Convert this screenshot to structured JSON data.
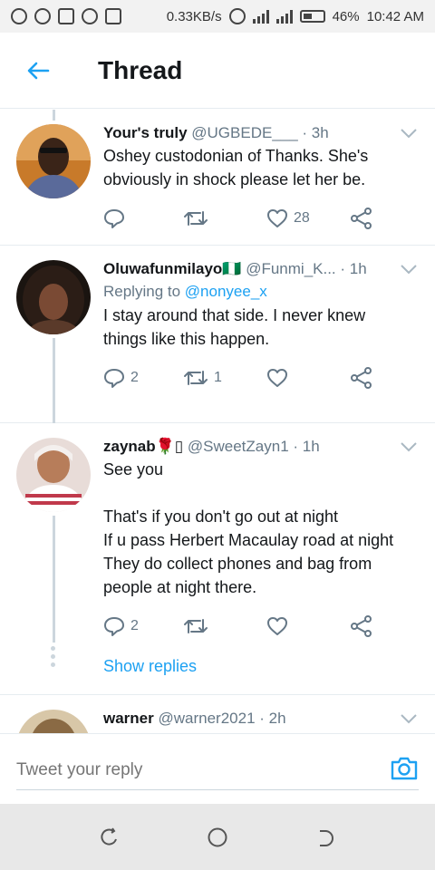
{
  "status_bar": {
    "speed": "0.33KB/s",
    "battery": "46%",
    "time": "10:42 AM",
    "battery_level": 0.46
  },
  "header": {
    "title": "Thread"
  },
  "tweets": [
    {
      "name": "Your's truly",
      "handle": "@UGBEDE___",
      "time": "· 3h",
      "replying_label": "",
      "replying_to": "",
      "text": "Oshey custodonian of Thanks. She's obviously in shock please let her be.",
      "reply_count": "",
      "retweet_count": "",
      "like_count": "28"
    },
    {
      "name": "Oluwafunmilayo🇳🇬",
      "handle": "@Funmi_K...",
      "time": "· 1h",
      "replying_label": "Replying to",
      "replying_to": "@nonyee_x",
      "text": "I stay around that side. I never knew things like this happen.",
      "reply_count": "2",
      "retweet_count": "1",
      "like_count": ""
    },
    {
      "name": "zaynab🌹▯",
      "handle": "@SweetZayn1",
      "time": "· 1h",
      "replying_label": "",
      "replying_to": "",
      "text": "See you\n\nThat's if you don't go out at night\nIf u pass Herbert Macaulay road at night\nThey do collect phones and bag from people at night there.",
      "reply_count": "2",
      "retweet_count": "",
      "like_count": ""
    },
    {
      "name": "warner",
      "handle": "@warner2021",
      "time": "· 2h"
    }
  ],
  "show_replies": "Show replies",
  "reply_bar": {
    "placeholder": "Tweet your reply"
  },
  "colors": {
    "accent": "#1da1f2",
    "secondary_text": "#657786",
    "divider": "#e6ecf0"
  }
}
